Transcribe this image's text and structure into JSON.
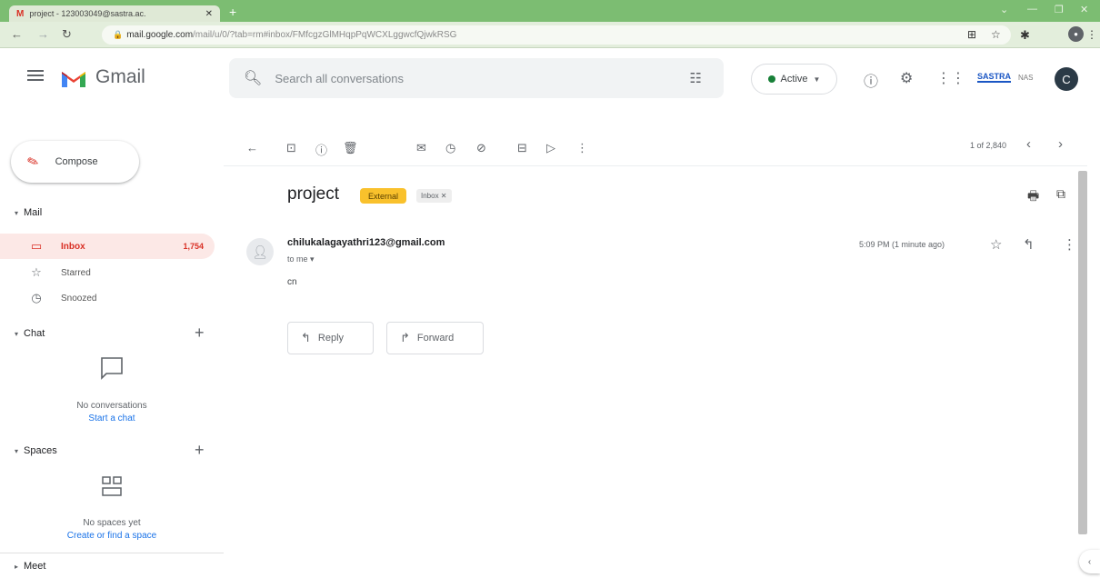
{
  "browser": {
    "tab_title": "project - 123003049@sastra.ac.",
    "tab_icon": "M",
    "tab_close": "✕",
    "new_tab": "+",
    "url_host": "mail.google.com",
    "url_path": "/mail/u/0/?tab=rm#inbox/FMfcgzGlMHqpPqWCXLggwcfQjwkRSG"
  },
  "gmail": {
    "brand": "Gmail",
    "search_placeholder": "Search all conversations",
    "status": "Active",
    "account_initial": "C",
    "logo_text": "SASTRA",
    "logo_subtext": "NAS"
  },
  "sidebar": {
    "compose_label": "Compose",
    "mail_section": "Mail",
    "inbox_label": "Inbox",
    "inbox_count": "1,754",
    "starred_label": "Starred",
    "snoozed_label": "Snoozed",
    "chat_section": "Chat",
    "chat_empty": "No conversations",
    "chat_link": "Start a chat",
    "spaces_section": "Spaces",
    "spaces_empty": "No spaces yet",
    "spaces_link": "Create or find a space",
    "meet_section": "Meet"
  },
  "message": {
    "pager": "1 of 2,840",
    "subject": "project",
    "label_external": "External",
    "label_inbox": "Inbox ✕",
    "sender": "chilukalagayathri123@gmail.com",
    "to": "to me ▾",
    "time": "5:09 PM (1 minute ago)",
    "body": "cn",
    "reply_label": "Reply",
    "forward_label": "Forward"
  },
  "colors": {
    "chrome_green": "#7cbd72",
    "gmail_red": "#d93025",
    "external_label": "#f9c12c",
    "link_blue": "#1a73e8"
  }
}
